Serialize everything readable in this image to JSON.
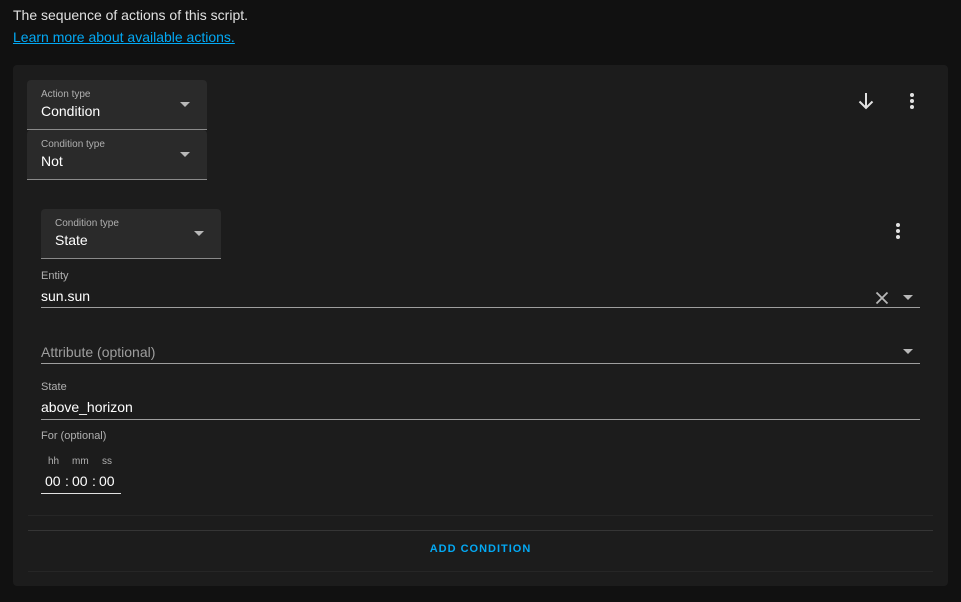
{
  "intro": {
    "description": "The sequence of actions of this script.",
    "learn_more": "Learn more about available actions."
  },
  "action": {
    "action_type_label": "Action type",
    "action_type_value": "Condition",
    "condition_type_label": "Condition type",
    "condition_type_value": "Not",
    "icons": [
      "arrow-down-icon",
      "more-vert-icon"
    ]
  },
  "nested_condition": {
    "condition_type_label": "Condition type",
    "condition_type_value": "State",
    "entity_label": "Entity",
    "entity_value": "sun.sun",
    "attribute_placeholder": "Attribute (optional)",
    "state_label": "State",
    "state_value": "above_horizon",
    "for_label": "For (optional)",
    "duration": {
      "hh_label": "hh",
      "mm_label": "mm",
      "ss_label": "ss",
      "hh": "00",
      "mm": "00",
      "ss": "00"
    }
  },
  "add_condition_label": "ADD CONDITION",
  "colors": {
    "background": "#111111",
    "card": "#1c1c1c",
    "field": "#2a2a2a",
    "accent": "#03a9f4"
  }
}
